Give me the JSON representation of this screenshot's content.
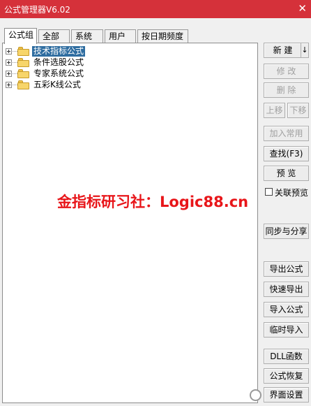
{
  "window": {
    "title": "公式管理器V6.02",
    "close_symbol": "✕"
  },
  "tabs": [
    {
      "label": "公式组",
      "active": true
    },
    {
      "label": "全部",
      "active": false
    },
    {
      "label": "系统",
      "active": false
    },
    {
      "label": "用户",
      "active": false
    },
    {
      "label": "按日期频度",
      "active": false
    }
  ],
  "tree": {
    "items": [
      {
        "label": "技术指标公式",
        "selected": true
      },
      {
        "label": "条件选股公式",
        "selected": false
      },
      {
        "label": "专家系统公式",
        "selected": false
      },
      {
        "label": "五彩K线公式",
        "selected": false
      }
    ]
  },
  "buttons": {
    "new": "新 建",
    "new_arrow": "↓",
    "modify": "修 改",
    "delete": "删 除",
    "move_up": "上移",
    "move_down": "下移",
    "add_common": "加入常用",
    "find": "查找(F3)",
    "preview": "预 览",
    "sync_share": "同步与分享",
    "export": "导出公式",
    "quick_export": "快速导出",
    "import": "导入公式",
    "temp_import": "临时导入",
    "dll_func": "DLL函数",
    "restore": "公式恢复",
    "settings": "界面设置"
  },
  "checkbox": {
    "linked_preview_label": "关联预览",
    "checked": false
  },
  "watermark": "金指标研习社：Logic88.cn",
  "logo_text": "界面设置",
  "colors": {
    "titlebar": "#d5313a",
    "selection": "#2f6da0",
    "watermark": "#e8161a"
  }
}
